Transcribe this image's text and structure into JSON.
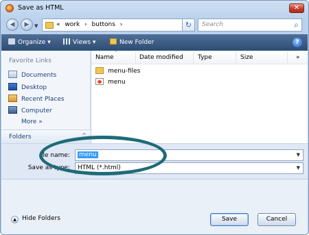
{
  "window": {
    "title": "Save as HTML",
    "close_glyph": "✕"
  },
  "nav": {
    "back_glyph": "◀",
    "forward_glyph": "▶",
    "dropdown_glyph": "▼",
    "address_parts": [
      "«",
      "work",
      "›",
      "buttons",
      "›"
    ],
    "refresh_glyph": "↻",
    "search_placeholder": "Search",
    "search_icon_glyph": "⌕"
  },
  "toolbar": {
    "organize_label": "Organize",
    "views_label": "Views",
    "new_folder_label": "New Folder",
    "dropdown_glyph": "▾",
    "help_glyph": "?"
  },
  "sidebar": {
    "heading": "Favorite Links",
    "items": [
      {
        "label": "Documents",
        "icon": "documents-icon"
      },
      {
        "label": "Desktop",
        "icon": "desktop-icon"
      },
      {
        "label": "Recent Places",
        "icon": "recent-places-icon"
      },
      {
        "label": "Computer",
        "icon": "computer-icon"
      }
    ],
    "more_label": "More",
    "more_glyph": "»",
    "folders_label": "Folders",
    "folders_glyph": "^"
  },
  "filelist": {
    "columns": [
      "Name",
      "Date modified",
      "Type",
      "Size"
    ],
    "sort_glyph": "˄",
    "col_dropdown_glyph": "▾",
    "overflow_glyph": "»",
    "rows": [
      {
        "name": "menu-files",
        "icon": "folder-icon"
      },
      {
        "name": "menu",
        "icon": "html-file-icon"
      }
    ]
  },
  "form": {
    "file_name_label": "le name:",
    "file_name_value": "menu",
    "save_type_label": "Save as type:",
    "save_type_value": "HTML (*.html)",
    "dropdown_glyph": "▼"
  },
  "footer": {
    "hide_folders_label": "Hide Folders",
    "hide_folders_glyph": "▲",
    "save_label": "Save",
    "cancel_label": "Cancel"
  },
  "colors": {
    "highlight_ellipse": "#1f6b78",
    "toolbar_bg": "#3b5b84",
    "selection": "#3399ff"
  }
}
